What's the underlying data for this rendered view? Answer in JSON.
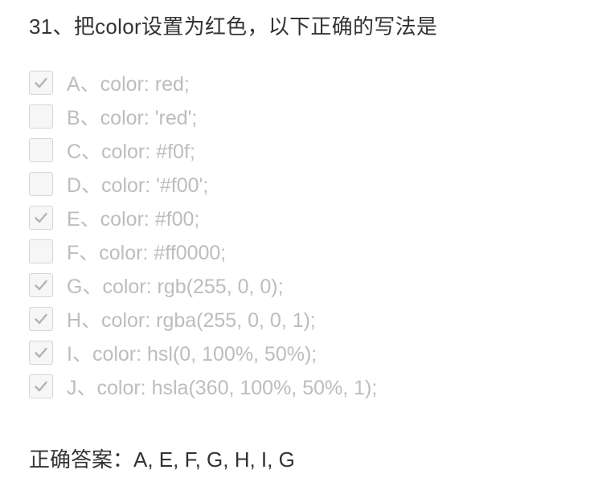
{
  "question": {
    "title": "31、把color设置为红色，以下正确的写法是"
  },
  "options": [
    {
      "label": "A、color: red;",
      "checked": true
    },
    {
      "label": "B、color: 'red';",
      "checked": false
    },
    {
      "label": "C、color: #f0f;",
      "checked": false
    },
    {
      "label": "D、color: '#f00';",
      "checked": false
    },
    {
      "label": "E、color: #f00;",
      "checked": true
    },
    {
      "label": "F、color: #ff0000;",
      "checked": false
    },
    {
      "label": "G、color: rgb(255, 0, 0);",
      "checked": true
    },
    {
      "label": "H、color: rgba(255, 0, 0, 1);",
      "checked": true
    },
    {
      "label": "I、color: hsl(0, 100%, 50%);",
      "checked": true
    },
    {
      "label": "J、color: hsla(360, 100%, 50%, 1);",
      "checked": true
    }
  ],
  "answer": {
    "text": "正确答案：A, E, F, G, H, I, G"
  },
  "colors": {
    "question_text": "#333333",
    "option_text": "#bdbdbd",
    "checkmark": "#b3b3b3",
    "checkbox_border": "#d6d6d6",
    "checkbox_bg": "#f6f6f6"
  },
  "icons": {
    "checkmark": "check-icon"
  }
}
